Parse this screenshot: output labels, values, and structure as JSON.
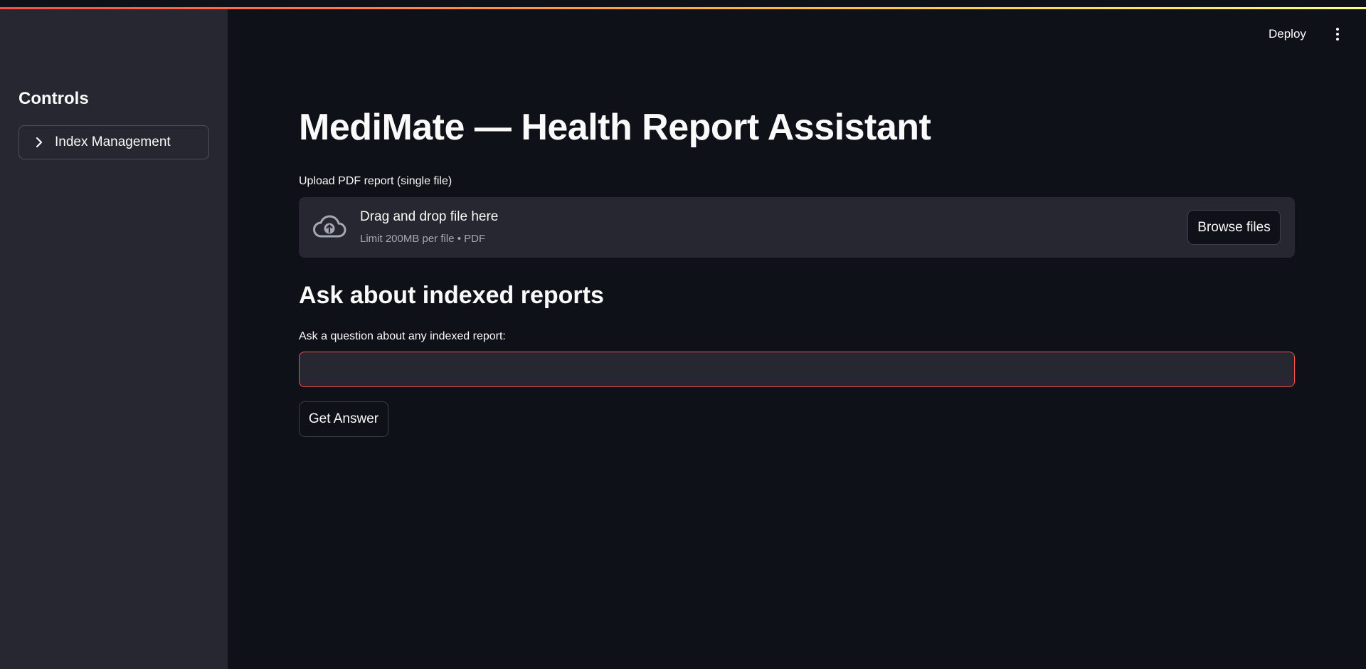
{
  "colors": {
    "background": "#0e1117",
    "sidebar": "#262730",
    "text": "#fafafa",
    "muted_text": "#a3a8b4",
    "accent": "#ff4b4b",
    "stripe_gradient": [
      "#ff4b4b",
      "#ffbd45",
      "#fffd80"
    ]
  },
  "header": {
    "deploy_label": "Deploy",
    "menu_icon": "kebab-vertical-icon"
  },
  "sidebar": {
    "title": "Controls",
    "expander": {
      "label": "Index Management",
      "icon": "chevron-right-icon",
      "expanded": false
    }
  },
  "main": {
    "title": "MediMate — Health Report Assistant",
    "uploader": {
      "label": "Upload PDF report (single file)",
      "icon": "cloud-upload-icon",
      "instruction": "Drag and drop file here",
      "limit_text": "Limit 200MB per file • PDF",
      "browse_label": "Browse files"
    },
    "ask_section": {
      "heading": "Ask about indexed reports",
      "input_label": "Ask a question about any indexed report:",
      "input_value": "",
      "submit_label": "Get Answer"
    }
  }
}
